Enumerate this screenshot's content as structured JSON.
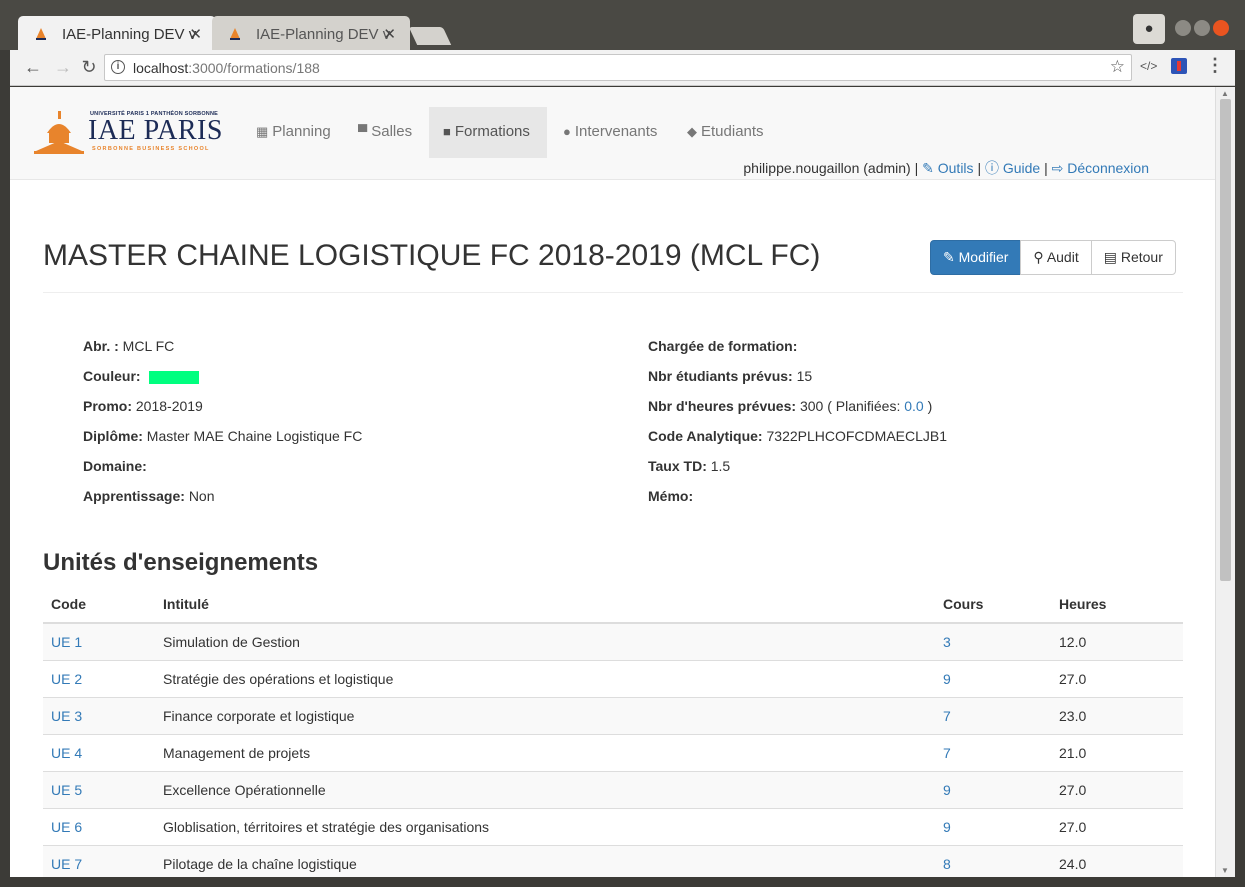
{
  "browser": {
    "tabs": [
      {
        "title": "IAE-Planning DEV v"
      },
      {
        "title": "IAE-Planning DEV v"
      }
    ],
    "url_host": "localhost",
    "url_rest": ":3000/formations/188"
  },
  "navbar": {
    "logo": {
      "univ": "UNIVERSITÉ PARIS 1 PANTHÉON SORBONNE",
      "name": "IAE PARIS",
      "school": "SORBONNE BUSINESS SCHOOL"
    },
    "items": [
      {
        "label": "Planning",
        "icon": "calendar-icon"
      },
      {
        "label": "Salles",
        "icon": "desk-icon"
      },
      {
        "label": "Formations",
        "icon": "briefcase-icon"
      },
      {
        "label": "Intervenants",
        "icon": "user-icon"
      },
      {
        "label": "Etudiants",
        "icon": "graduation-cap-icon"
      }
    ],
    "user": "philippe.nougaillon (admin) |",
    "sep": "|",
    "outils": "Outils",
    "guide": "Guide",
    "logout": "Déconnexion"
  },
  "page": {
    "title": "MASTER CHAINE LOGISTIQUE FC 2018-2019 (MCL FC)",
    "buttons": {
      "edit": "Modifier",
      "audit": "Audit",
      "back": "Retour"
    }
  },
  "details": {
    "abr_label": "Abr. :",
    "abr": "MCL FC",
    "couleur_label": "Couleur:",
    "couleur": "#00ff7f",
    "promo_label": "Promo:",
    "promo": "2018-2019",
    "diplome_label": "Diplôme:",
    "diplome": "Master MAE Chaine Logistique FC",
    "domaine_label": "Domaine:",
    "apprentissage_label": "Apprentissage:",
    "apprentissage": "Non",
    "chargee_label": "Chargée de formation:",
    "nbr_etudiants_label": "Nbr étudiants prévus:",
    "nbr_etudiants": "15",
    "nbr_heures_label": "Nbr d'heures prévues:",
    "nbr_heures": "300",
    "planifiees_label": "( Planifiées:",
    "planifiees": "0.0",
    "planifiees_close": ")",
    "code_analytique_label": "Code Analytique:",
    "code_analytique": "7322PLHCOFCDMAECLJB1",
    "taux_td_label": "Taux TD:",
    "taux_td": "1.5",
    "memo_label": "Mémo:"
  },
  "ue": {
    "title": "Unités d'enseignements",
    "headers": {
      "code": "Code",
      "intitule": "Intitulé",
      "cours": "Cours",
      "heures": "Heures"
    },
    "rows": [
      {
        "code": "UE 1",
        "intitule": "Simulation de Gestion",
        "cours": "3",
        "heures": "12.0"
      },
      {
        "code": "UE 2",
        "intitule": "Stratégie des opérations et logistique",
        "cours": "9",
        "heures": "27.0"
      },
      {
        "code": "UE 3",
        "intitule": "Finance corporate et logistique",
        "cours": "7",
        "heures": "23.0"
      },
      {
        "code": "UE 4",
        "intitule": "Management de projets",
        "cours": "7",
        "heures": "21.0"
      },
      {
        "code": "UE 5",
        "intitule": "Excellence Opérationnelle",
        "cours": "9",
        "heures": "27.0"
      },
      {
        "code": "UE 6",
        "intitule": "Globlisation, térritoires et stratégie des organisations",
        "cours": "9",
        "heures": "27.0"
      },
      {
        "code": "UE 7",
        "intitule": "Pilotage de la chaîne logistique",
        "cours": "8",
        "heures": "24.0"
      }
    ]
  }
}
